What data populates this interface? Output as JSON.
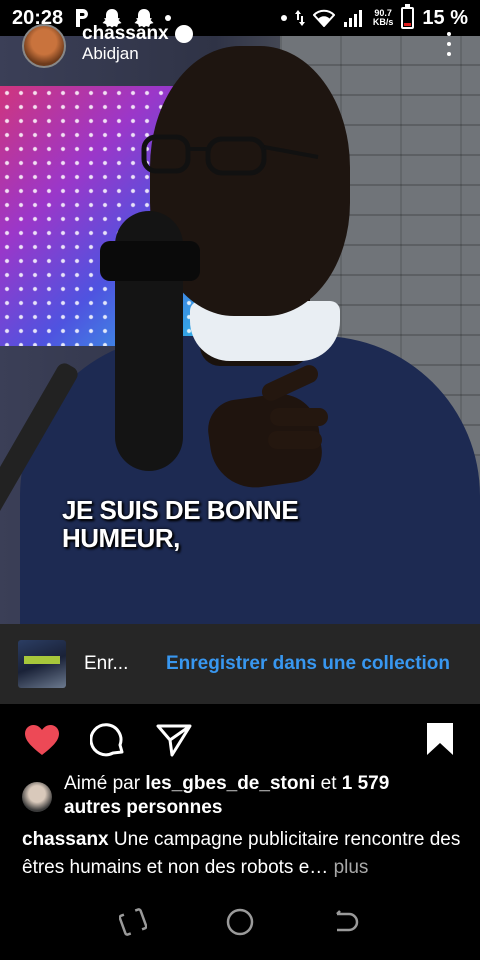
{
  "status_bar": {
    "time": "20:28",
    "net_speed_value": "90.7",
    "net_speed_unit": "KB/s",
    "battery": "15 %",
    "battery_level": 0.15,
    "icons": [
      "parking-icon",
      "snapchat-icon",
      "snapchat-icon",
      "dot-icon",
      "dot-icon",
      "data-arrows-icon",
      "wifi-icon",
      "signal-icon",
      "battery-icon"
    ]
  },
  "post": {
    "username": "chassanx",
    "location": "Abidjan",
    "video_caption_line1": "JE SUIS DE BONNE",
    "video_caption_line2": "HUMEUR,"
  },
  "save_bar": {
    "name": "Enr...",
    "collection_label": "Enregistrer dans une collection"
  },
  "actions": {
    "like_icon": "heart-filled-icon",
    "comment_icon": "comment-icon",
    "share_icon": "send-icon",
    "save_icon": "bookmark-filled-icon",
    "like_color": "#ed4956"
  },
  "likes": {
    "prefix": "Aimé par ",
    "user": "les_gbes_de_stoni",
    "middle": " et ",
    "count": "1 579",
    "suffix": "autres personnes"
  },
  "caption": {
    "user": "chassanx",
    "text": " Une campagne publicitaire rencontre des êtres humains et non des robots e",
    "ellipsis": "…",
    "more": " plus"
  },
  "navbar": {
    "icons": [
      "recent-apps-icon",
      "home-icon",
      "back-icon"
    ]
  },
  "colors": {
    "accent_blue": "#3897f0",
    "background": "#000000",
    "save_bar_bg": "#262626"
  }
}
